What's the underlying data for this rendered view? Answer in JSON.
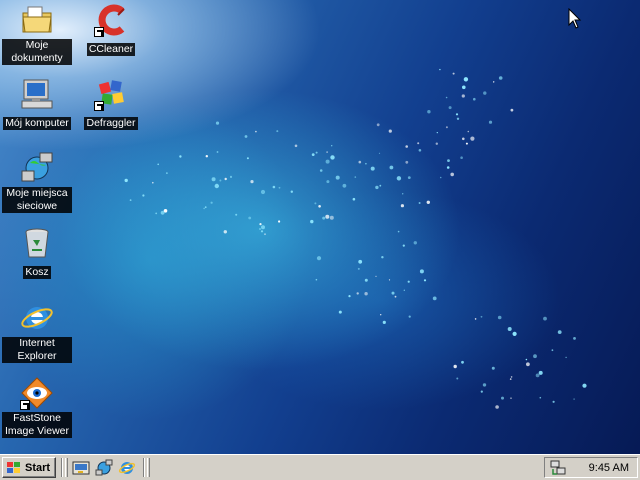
{
  "desktop": {
    "icons": [
      {
        "label": "Moje dokumenty",
        "icon": "folder-documents-icon"
      },
      {
        "label": "CCleaner",
        "icon": "ccleaner-icon",
        "shortcut": true
      },
      {
        "label": "Mój komputer",
        "icon": "computer-icon"
      },
      {
        "label": "Defraggler",
        "icon": "defraggler-icon",
        "shortcut": true
      },
      {
        "label": "Moje miejsca sieciowe",
        "icon": "network-places-icon"
      },
      {
        "label": "Kosz",
        "icon": "recycle-bin-icon"
      },
      {
        "label": "Internet Explorer",
        "icon": "internet-explorer-icon"
      },
      {
        "label": "FastStone Image Viewer",
        "icon": "faststone-icon",
        "shortcut": true
      }
    ]
  },
  "taskbar": {
    "start_label": "Start",
    "quick_launch": [
      "show-desktop-icon",
      "network-icon",
      "internet-explorer-icon"
    ],
    "clock": "9:45 AM",
    "tray_icon": "network-connection-icon"
  },
  "colors": {
    "taskbar": "#d4d0c8",
    "label_bg": "#000000",
    "wallpaper_dark": "#0b2a72",
    "wallpaper_light": "#4a8ccd"
  }
}
